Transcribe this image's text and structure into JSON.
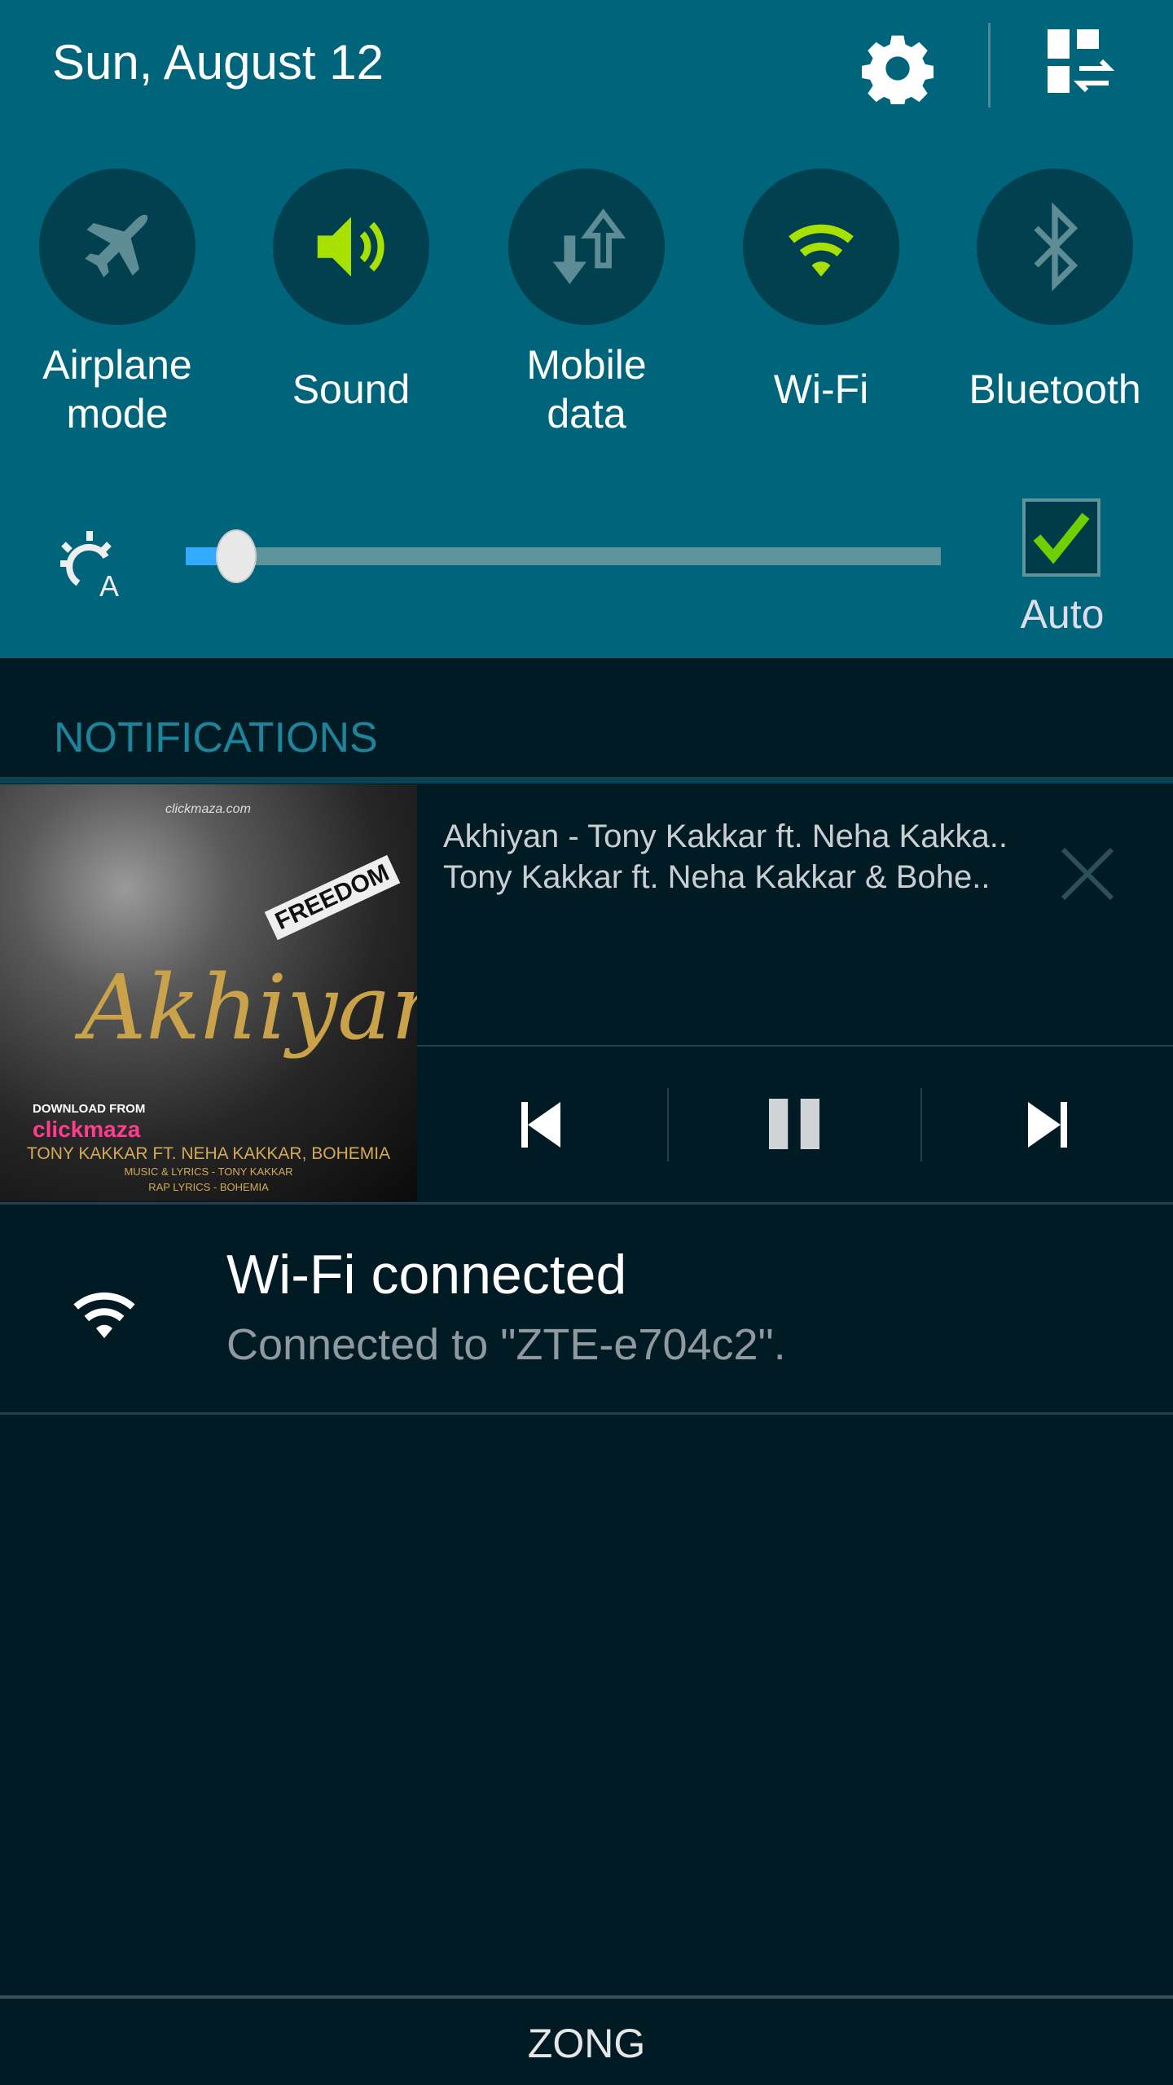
{
  "header": {
    "date": "Sun, August 12",
    "settings_icon": "gear-icon",
    "edit_icon": "grid-swap-icon"
  },
  "toggles": [
    {
      "label": "Airplane mode",
      "line1": "Airplane",
      "line2": "mode",
      "on": false
    },
    {
      "label": "Sound",
      "line1": "Sound",
      "line2": "",
      "on": true
    },
    {
      "label": "Mobile data",
      "line1": "Mobile",
      "line2": "data",
      "on": false
    },
    {
      "label": "Wi-Fi",
      "line1": "Wi-Fi",
      "line2": "",
      "on": true
    },
    {
      "label": "Bluetooth",
      "line1": "Bluetooth",
      "line2": "",
      "on": false
    }
  ],
  "brightness": {
    "level": 0.04,
    "auto_label": "Auto",
    "auto_checked": true
  },
  "notifications": {
    "heading": "NOTIFICATIONS",
    "media": {
      "title": "Akhiyan - Tony Kakkar ft. Neha Kakka..",
      "artist": "Tony Kakkar ft. Neha Kakkar & Bohe..",
      "art": {
        "site": "clickmaza.com",
        "script_title": "Akhiyan",
        "download": "DOWNLOAD FROM",
        "brand": "clickmaza",
        "credits": "TONY KAKKAR FT. NEHA KAKKAR, BOHEMIA",
        "music": "MUSIC & LYRICS - TONY KAKKAR",
        "rap": "RAP LYRICS - BOHEMIA",
        "shirt": "FREEDOM"
      }
    },
    "wifi": {
      "title": "Wi-Fi connected",
      "subtitle": "Connected to \"ZTE-e704c2\"."
    }
  },
  "carrier": "ZONG",
  "colors": {
    "panel": "#00657a",
    "circle": "#00404f",
    "accent_on": "#a8e000",
    "background": "#011b25"
  }
}
